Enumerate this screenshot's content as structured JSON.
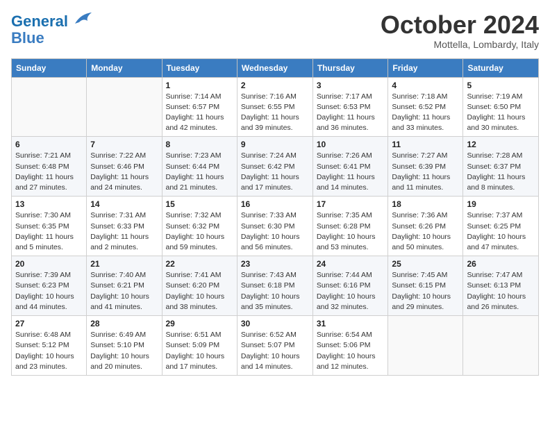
{
  "header": {
    "logo_general": "General",
    "logo_blue": "Blue",
    "month": "October 2024",
    "location": "Mottella, Lombardy, Italy"
  },
  "days_of_week": [
    "Sunday",
    "Monday",
    "Tuesday",
    "Wednesday",
    "Thursday",
    "Friday",
    "Saturday"
  ],
  "weeks": [
    [
      {
        "day": "",
        "info": ""
      },
      {
        "day": "",
        "info": ""
      },
      {
        "day": "1",
        "info": "Sunrise: 7:14 AM\nSunset: 6:57 PM\nDaylight: 11 hours and 42 minutes."
      },
      {
        "day": "2",
        "info": "Sunrise: 7:16 AM\nSunset: 6:55 PM\nDaylight: 11 hours and 39 minutes."
      },
      {
        "day": "3",
        "info": "Sunrise: 7:17 AM\nSunset: 6:53 PM\nDaylight: 11 hours and 36 minutes."
      },
      {
        "day": "4",
        "info": "Sunrise: 7:18 AM\nSunset: 6:52 PM\nDaylight: 11 hours and 33 minutes."
      },
      {
        "day": "5",
        "info": "Sunrise: 7:19 AM\nSunset: 6:50 PM\nDaylight: 11 hours and 30 minutes."
      }
    ],
    [
      {
        "day": "6",
        "info": "Sunrise: 7:21 AM\nSunset: 6:48 PM\nDaylight: 11 hours and 27 minutes."
      },
      {
        "day": "7",
        "info": "Sunrise: 7:22 AM\nSunset: 6:46 PM\nDaylight: 11 hours and 24 minutes."
      },
      {
        "day": "8",
        "info": "Sunrise: 7:23 AM\nSunset: 6:44 PM\nDaylight: 11 hours and 21 minutes."
      },
      {
        "day": "9",
        "info": "Sunrise: 7:24 AM\nSunset: 6:42 PM\nDaylight: 11 hours and 17 minutes."
      },
      {
        "day": "10",
        "info": "Sunrise: 7:26 AM\nSunset: 6:41 PM\nDaylight: 11 hours and 14 minutes."
      },
      {
        "day": "11",
        "info": "Sunrise: 7:27 AM\nSunset: 6:39 PM\nDaylight: 11 hours and 11 minutes."
      },
      {
        "day": "12",
        "info": "Sunrise: 7:28 AM\nSunset: 6:37 PM\nDaylight: 11 hours and 8 minutes."
      }
    ],
    [
      {
        "day": "13",
        "info": "Sunrise: 7:30 AM\nSunset: 6:35 PM\nDaylight: 11 hours and 5 minutes."
      },
      {
        "day": "14",
        "info": "Sunrise: 7:31 AM\nSunset: 6:33 PM\nDaylight: 11 hours and 2 minutes."
      },
      {
        "day": "15",
        "info": "Sunrise: 7:32 AM\nSunset: 6:32 PM\nDaylight: 10 hours and 59 minutes."
      },
      {
        "day": "16",
        "info": "Sunrise: 7:33 AM\nSunset: 6:30 PM\nDaylight: 10 hours and 56 minutes."
      },
      {
        "day": "17",
        "info": "Sunrise: 7:35 AM\nSunset: 6:28 PM\nDaylight: 10 hours and 53 minutes."
      },
      {
        "day": "18",
        "info": "Sunrise: 7:36 AM\nSunset: 6:26 PM\nDaylight: 10 hours and 50 minutes."
      },
      {
        "day": "19",
        "info": "Sunrise: 7:37 AM\nSunset: 6:25 PM\nDaylight: 10 hours and 47 minutes."
      }
    ],
    [
      {
        "day": "20",
        "info": "Sunrise: 7:39 AM\nSunset: 6:23 PM\nDaylight: 10 hours and 44 minutes."
      },
      {
        "day": "21",
        "info": "Sunrise: 7:40 AM\nSunset: 6:21 PM\nDaylight: 10 hours and 41 minutes."
      },
      {
        "day": "22",
        "info": "Sunrise: 7:41 AM\nSunset: 6:20 PM\nDaylight: 10 hours and 38 minutes."
      },
      {
        "day": "23",
        "info": "Sunrise: 7:43 AM\nSunset: 6:18 PM\nDaylight: 10 hours and 35 minutes."
      },
      {
        "day": "24",
        "info": "Sunrise: 7:44 AM\nSunset: 6:16 PM\nDaylight: 10 hours and 32 minutes."
      },
      {
        "day": "25",
        "info": "Sunrise: 7:45 AM\nSunset: 6:15 PM\nDaylight: 10 hours and 29 minutes."
      },
      {
        "day": "26",
        "info": "Sunrise: 7:47 AM\nSunset: 6:13 PM\nDaylight: 10 hours and 26 minutes."
      }
    ],
    [
      {
        "day": "27",
        "info": "Sunrise: 6:48 AM\nSunset: 5:12 PM\nDaylight: 10 hours and 23 minutes."
      },
      {
        "day": "28",
        "info": "Sunrise: 6:49 AM\nSunset: 5:10 PM\nDaylight: 10 hours and 20 minutes."
      },
      {
        "day": "29",
        "info": "Sunrise: 6:51 AM\nSunset: 5:09 PM\nDaylight: 10 hours and 17 minutes."
      },
      {
        "day": "30",
        "info": "Sunrise: 6:52 AM\nSunset: 5:07 PM\nDaylight: 10 hours and 14 minutes."
      },
      {
        "day": "31",
        "info": "Sunrise: 6:54 AM\nSunset: 5:06 PM\nDaylight: 10 hours and 12 minutes."
      },
      {
        "day": "",
        "info": ""
      },
      {
        "day": "",
        "info": ""
      }
    ]
  ]
}
